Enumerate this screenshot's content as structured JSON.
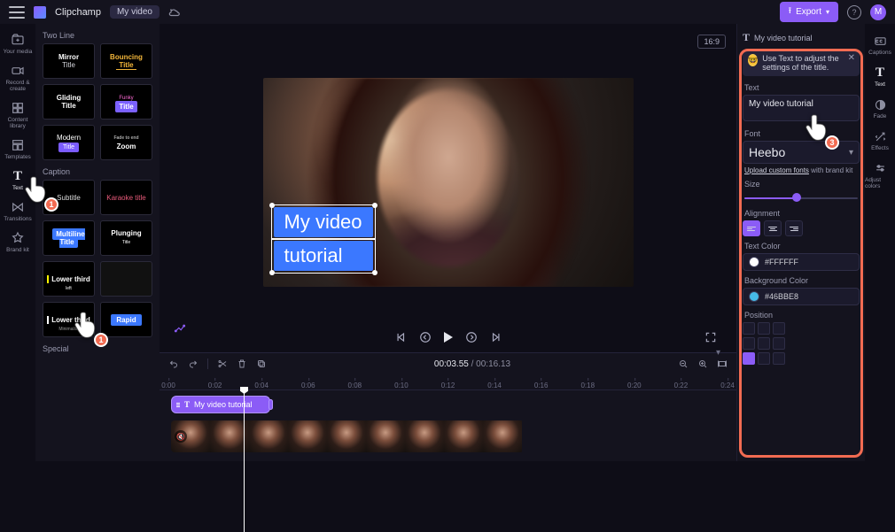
{
  "brand": "Clipchamp",
  "topbar": {
    "video_title": "My video",
    "export_label": "Export",
    "avatar_initial": "M"
  },
  "rail": {
    "items": [
      {
        "id": "your-media",
        "label": "Your media"
      },
      {
        "id": "record-create",
        "label": "Record & create"
      },
      {
        "id": "content-lib",
        "label": "Content library"
      },
      {
        "id": "templates",
        "label": "Templates"
      },
      {
        "id": "text",
        "label": "Text"
      },
      {
        "id": "transitions",
        "label": "Transitions"
      },
      {
        "id": "brand-kit",
        "label": "Brand kit"
      }
    ]
  },
  "titles": {
    "section1": "Two Line",
    "section2": "Caption",
    "section3": "Special",
    "cards": {
      "mirror": "Mirror",
      "mirror_sub": "Title",
      "bouncing": "Bouncing",
      "bouncing_sub": "Title",
      "gliding": "Gliding",
      "gliding_sub": "Title",
      "funky": "Funky",
      "funky_sub": "Title",
      "modern": "Modern",
      "modern_sub": "Title",
      "zoom": "Zoom",
      "zoom_sub": "Fade to end",
      "subtitle": "Subtitle",
      "karaoke": "Karaoke title",
      "multiline": "Multiline",
      "multiline_sub": "Title",
      "plunging": "Plunging",
      "plunging_sub": "Title",
      "lowerthird1": "Lower third",
      "lowerthird1_sub": "left",
      "lowerthird2": "Lower third",
      "lowerthird2_sub": "Minimalist",
      "rapid": "Rapid"
    }
  },
  "stage": {
    "aspect": "16:9",
    "overlay_line1": "My video",
    "overlay_line2": "tutorial"
  },
  "transport": {
    "current": "00:03.55",
    "total": "00:16.13"
  },
  "timeline": {
    "ticks": [
      "0:00",
      "0:02",
      "0:04",
      "0:06",
      "0:08",
      "0:10",
      "0:12",
      "0:14",
      "0:16",
      "0:18",
      "0:20",
      "0:22",
      "0:24"
    ],
    "text_clip_label": "My video tutorial"
  },
  "rpanel": {
    "header": "My video tutorial",
    "hint": "Use Text to adjust the settings of the title.",
    "text_label": "Text",
    "text_value": "My video tutorial",
    "font_label": "Font",
    "font_value": "Heebo",
    "upload_link": "Upload custom fonts",
    "upload_tail": " with brand kit",
    "size_label": "Size",
    "align_label": "Alignment",
    "tcolor_label": "Text Color",
    "tcolor_value": "#FFFFFF",
    "bgcolor_label": "Background Color",
    "bgcolor_value": "#46BBE8",
    "position_label": "Position"
  },
  "rrail": {
    "items": [
      {
        "id": "captions",
        "label": "Captions"
      },
      {
        "id": "text",
        "label": "Text"
      },
      {
        "id": "fade",
        "label": "Fade"
      },
      {
        "id": "effects",
        "label": "Effects"
      },
      {
        "id": "adjust",
        "label": "Adjust colors"
      }
    ]
  },
  "steps": {
    "one": "1",
    "one_b": "1",
    "three": "3"
  }
}
